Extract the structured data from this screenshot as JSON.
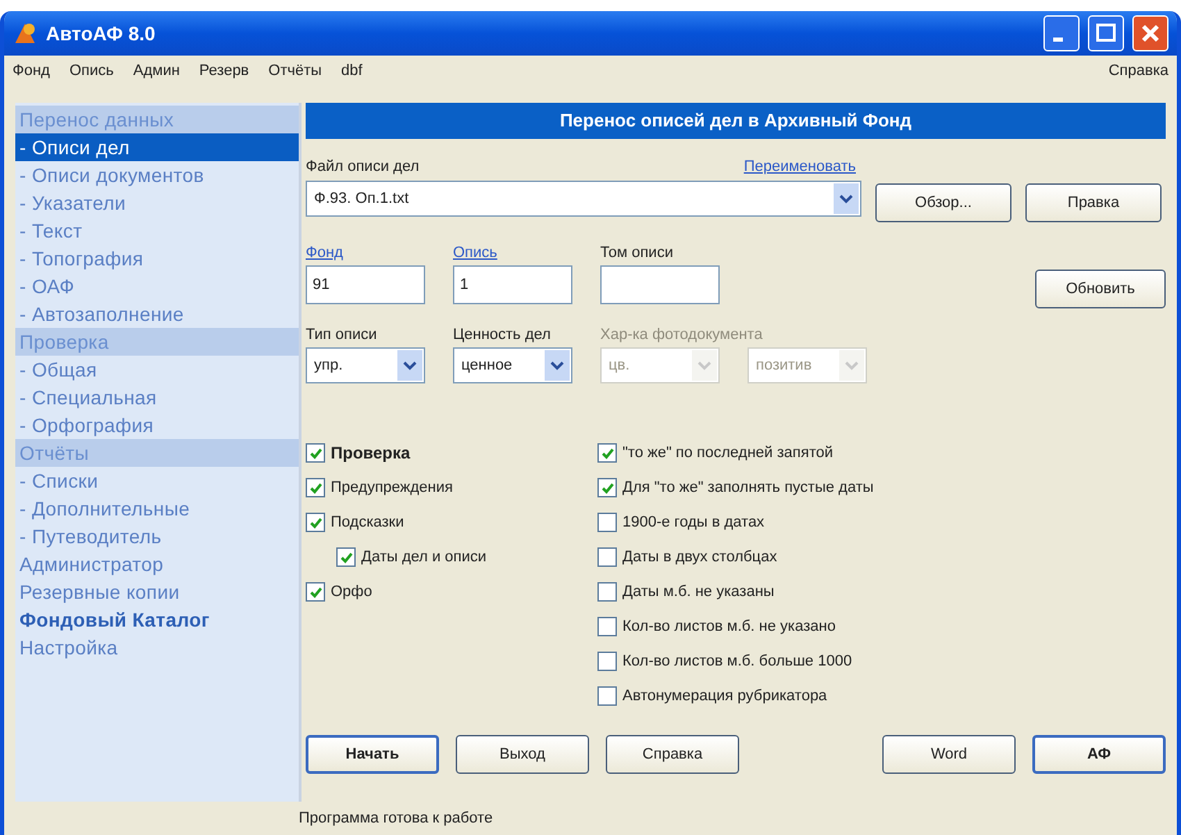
{
  "window": {
    "title": "АвтоАФ 8.0"
  },
  "menu": [
    {
      "label": "Фонд"
    },
    {
      "label": "Опись"
    },
    {
      "label": "Админ"
    },
    {
      "label": "Резерв"
    },
    {
      "label": "Отчёты"
    },
    {
      "label": "dbf"
    }
  ],
  "menu_help": "Справка",
  "sidebar": {
    "items": [
      {
        "label": "Перенос данных",
        "kind": "section",
        "selected": false
      },
      {
        "label": "- Описи дел",
        "kind": "item",
        "selected": true
      },
      {
        "label": "- Описи документов",
        "kind": "item",
        "selected": false
      },
      {
        "label": "- Указатели",
        "kind": "item",
        "selected": false
      },
      {
        "label": "- Текст",
        "kind": "item",
        "selected": false
      },
      {
        "label": "- Топография",
        "kind": "item",
        "selected": false
      },
      {
        "label": "- ОАФ",
        "kind": "item",
        "selected": false
      },
      {
        "label": "- Автозаполнение",
        "kind": "item",
        "selected": false
      },
      {
        "label": "Проверка",
        "kind": "section",
        "selected": false
      },
      {
        "label": "- Общая",
        "kind": "item",
        "selected": false
      },
      {
        "label": "- Специальная",
        "kind": "item",
        "selected": false
      },
      {
        "label": "- Орфография",
        "kind": "item",
        "selected": false
      },
      {
        "label": "Отчёты",
        "kind": "section",
        "selected": false
      },
      {
        "label": "- Списки",
        "kind": "item",
        "selected": false
      },
      {
        "label": "- Дополнительные",
        "kind": "item",
        "selected": false
      },
      {
        "label": "- Путеводитель",
        "kind": "item",
        "selected": false
      },
      {
        "label": "Администратор",
        "kind": "top",
        "selected": false
      },
      {
        "label": "Резервные копии",
        "kind": "top",
        "selected": false
      },
      {
        "label": "Фондовый Каталог",
        "kind": "strong",
        "selected": false
      },
      {
        "label": "Настройка",
        "kind": "top",
        "selected": false
      }
    ]
  },
  "panel": {
    "title": "Перенос описей дел в Архивный Фонд",
    "file": {
      "label": "Файл описи дел",
      "value": "Ф.93. Оп.1.txt",
      "rename_link": "Переименовать"
    },
    "file_buttons": [
      "Обзор...",
      "Правка"
    ],
    "fields": [
      {
        "label": "Фонд",
        "value": "91",
        "link": true
      },
      {
        "label": "Опись",
        "value": "1",
        "link": true
      },
      {
        "label": "Том описи",
        "link": false
      }
    ],
    "refresh_button": "Обновить",
    "dropdowns": [
      {
        "label": "Тип описи",
        "value": "упр.",
        "disabled": false
      },
      {
        "label": "Ценность дел",
        "value": "ценное",
        "disabled": false
      },
      {
        "label": "Хар-ка фотодокумента",
        "value": "цв.",
        "disabled": true
      },
      {
        "value": "позитив",
        "disabled": true
      }
    ],
    "checks_left": [
      {
        "label": "Проверка",
        "checked": true,
        "bold": true
      },
      {
        "label": "Предупреждения",
        "checked": true,
        "bold": false
      },
      {
        "label": "Подсказки",
        "checked": true,
        "bold": false,
        "children": [
          {
            "label": "Даты дел и описи",
            "checked": true,
            "bold": false
          }
        ]
      },
      {
        "label": "Орфо",
        "checked": true,
        "bold": false
      }
    ],
    "checks_right": [
      {
        "label": "\"то же\" по последней запятой",
        "checked": true
      },
      {
        "label": "Для \"то же\" заполнять пустые даты",
        "checked": true
      },
      {
        "label": "1900-е годы в датах",
        "checked": false
      },
      {
        "label": "Даты в двух столбцах",
        "checked": false
      },
      {
        "label": "Даты м.б. не указаны",
        "checked": false
      },
      {
        "label": "Кол-во листов м.б. не указано",
        "checked": false
      },
      {
        "label": "Кол-во листов м.б. больше 1000",
        "checked": false
      },
      {
        "label": "Автонумерация рубрикатора",
        "checked": false
      }
    ],
    "buttons_left": [
      {
        "label": "Начать",
        "default": true
      },
      {
        "label": "Выход",
        "default": false
      },
      {
        "label": "Справка",
        "default": false
      }
    ],
    "buttons_right": [
      {
        "label": "Word",
        "default": false
      },
      {
        "label": "АФ",
        "default": true
      }
    ]
  },
  "status_bar": "Программа готова к работе"
}
